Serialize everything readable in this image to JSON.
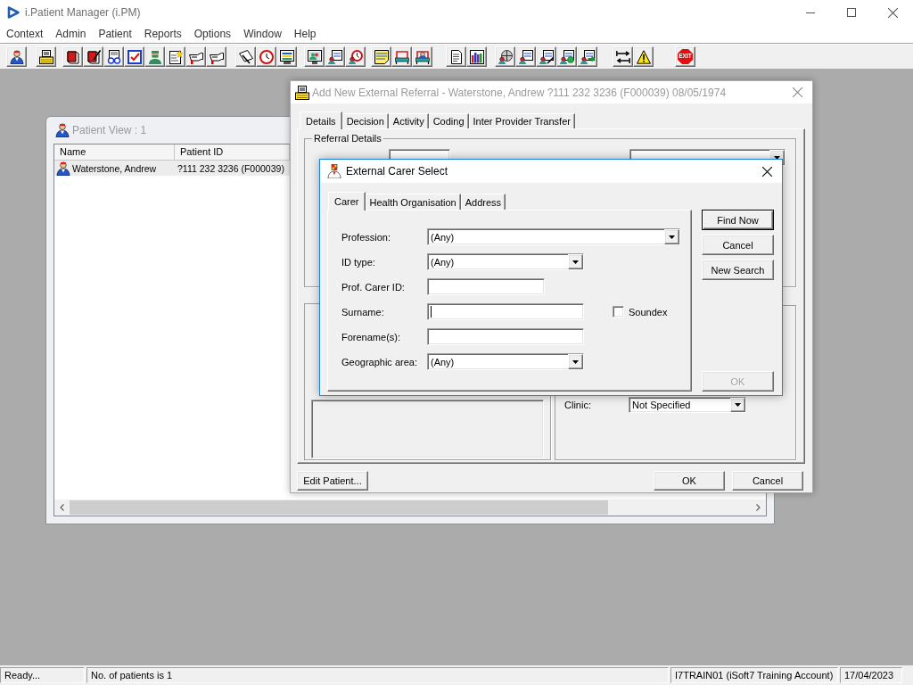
{
  "window": {
    "title": "i.Patient Manager (i.PM)"
  },
  "menu": [
    "Context",
    "Admin",
    "Patient",
    "Reports",
    "Options",
    "Window",
    "Help"
  ],
  "toolbar": {
    "exit_label": "EXIT"
  },
  "patient_view": {
    "title": "Patient View : 1",
    "active": false,
    "columns": [
      "Name",
      "Patient ID"
    ],
    "rows": [
      {
        "cells": [
          "Waterstone, Andrew",
          "?111 232 3236 (F000039)"
        ],
        "selected": true
      }
    ]
  },
  "referral_dialog": {
    "title": "Add New External Referral - Waterstone, Andrew ?111 232 3236 (F000039) 08/05/1974",
    "active": false,
    "tabs": [
      {
        "label": "Details",
        "selected": true
      },
      {
        "label": "Decision",
        "selected": false
      },
      {
        "label": "Activity",
        "selected": false
      },
      {
        "label": "Coding",
        "selected": false
      },
      {
        "label": "Inter Provider Transfer",
        "selected": false
      }
    ],
    "group_title": "Referral Details",
    "clinic": {
      "label": "Clinic:",
      "value": "Not Specified"
    },
    "buttons": [
      {
        "label": "Edit Patient..."
      },
      {
        "label": "OK"
      },
      {
        "label": "Cancel"
      }
    ]
  },
  "carer_dialog": {
    "title": "External Carer Select",
    "active": true,
    "tabs": [
      {
        "label": "Carer",
        "selected": true
      },
      {
        "label": "Health Organisation",
        "selected": false
      },
      {
        "label": "Address",
        "selected": false
      }
    ],
    "fields": [
      {
        "label": "Profession:",
        "kind": "combo",
        "value": "(Any)"
      },
      {
        "label": "ID type:",
        "kind": "combo",
        "value": "(Any)"
      },
      {
        "label": "Prof. Carer ID:",
        "kind": "text",
        "focused": false
      },
      {
        "label": "Surname:",
        "kind": "text",
        "focused": true,
        "option": {
          "label": "Soundex",
          "checked": false
        }
      },
      {
        "label": "Forename(s):",
        "kind": "text",
        "focused": false
      },
      {
        "label": "Geographic area:",
        "kind": "combo",
        "value": "(Any)"
      }
    ],
    "buttons": [
      {
        "label": "Find Now",
        "default": true,
        "disabled": false
      },
      {
        "label": "Cancel",
        "default": false,
        "disabled": false
      },
      {
        "label": "New Search",
        "default": false,
        "disabled": false
      },
      {
        "label": "OK",
        "default": false,
        "disabled": true
      }
    ]
  },
  "status_bar": [
    "Ready...",
    "No. of patients is 1",
    "I7TRAIN01 (iSoft7 Training Account)",
    "17/04/2023"
  ]
}
